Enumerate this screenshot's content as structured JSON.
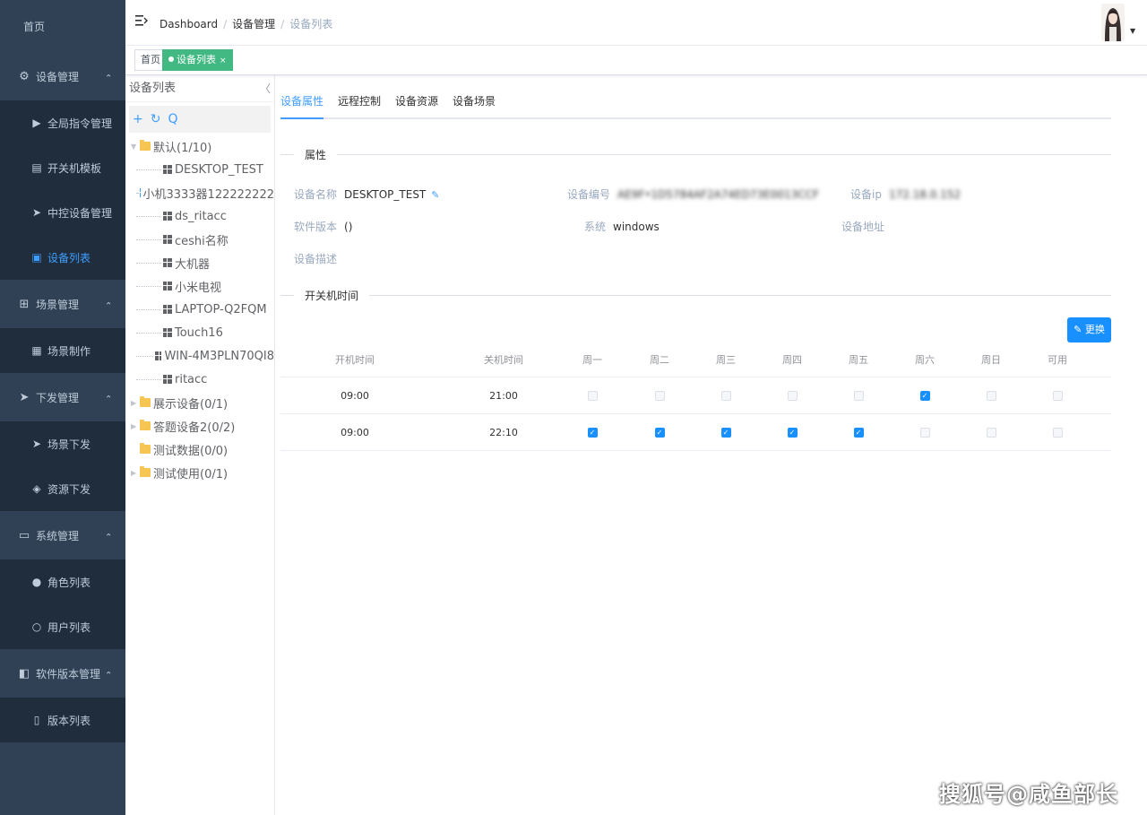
{
  "sidebar": {
    "home": "首页",
    "groups": [
      {
        "label": "设备管理",
        "icon": "gear-icon",
        "items": [
          {
            "label": "全局指令管理",
            "icon": "play-icon"
          },
          {
            "label": "开关机模板",
            "icon": "template-icon"
          },
          {
            "label": "中控设备管理",
            "icon": "send-icon"
          },
          {
            "label": "设备列表",
            "icon": "device-list-icon",
            "active": true
          }
        ]
      },
      {
        "label": "场景管理",
        "icon": "scene-icon",
        "items": [
          {
            "label": "场景制作",
            "icon": "clapper-icon"
          }
        ]
      },
      {
        "label": "下发管理",
        "icon": "send-icon",
        "items": [
          {
            "label": "场景下发",
            "icon": "send-icon"
          },
          {
            "label": "资源下发",
            "icon": "layers-icon"
          }
        ]
      },
      {
        "label": "系统管理",
        "icon": "monitor-icon",
        "items": [
          {
            "label": "角色列表",
            "icon": "users-icon"
          },
          {
            "label": "用户列表",
            "icon": "user-icon"
          }
        ]
      },
      {
        "label": "软件版本管理",
        "icon": "version-icon",
        "items": [
          {
            "label": "版本列表",
            "icon": "document-icon"
          }
        ]
      }
    ]
  },
  "header": {
    "breadcrumb": [
      "Dashboard",
      "设备管理",
      "设备列表"
    ]
  },
  "tags": {
    "home": "首页",
    "active": "设备列表",
    "close": "×"
  },
  "tree": {
    "title": "设备列表",
    "collapse": "〈",
    "tools": {
      "add": "+",
      "refresh": "↻",
      "search": "Q"
    },
    "groups": [
      {
        "label": "默认(1/10)",
        "expanded": true,
        "children": [
          {
            "label": "DESKTOP_TEST",
            "online": false
          },
          {
            "label": "小机3333器122222222",
            "online": true
          },
          {
            "label": "ds_ritacc",
            "online": false
          },
          {
            "label": "ceshi名称",
            "online": false
          },
          {
            "label": "大机器",
            "online": false
          },
          {
            "label": "小米电视",
            "online": false
          },
          {
            "label": "LAPTOP-Q2FQM",
            "online": false
          },
          {
            "label": "Touch16",
            "online": false
          },
          {
            "label": "WIN-4M3PLN70QI8",
            "online": false
          },
          {
            "label": "ritacc",
            "online": false
          }
        ]
      },
      {
        "label": "展示设备(0/1)",
        "expanded": false,
        "has_arrow": true
      },
      {
        "label": "答题设备2(0/2)",
        "expanded": false,
        "has_arrow": true
      },
      {
        "label": "测试数据(0/0)",
        "expanded": false,
        "has_arrow": false
      },
      {
        "label": "测试使用(0/1)",
        "expanded": false,
        "has_arrow": true
      }
    ]
  },
  "tabs": [
    "设备属性",
    "远程控制",
    "设备资源",
    "设备场景"
  ],
  "properties": {
    "section_title": "属性",
    "name_label": "设备名称",
    "name_value": "DESKTOP_TEST",
    "id_label": "设备编号",
    "id_value": "AE9F•1D5784AF2A74ED73E0013CCF",
    "ip_label": "设备ip",
    "ip_value": "172.18.0.152",
    "version_label": "软件版本",
    "version_value": "()",
    "system_label": "系统",
    "system_value": "windows",
    "address_label": "设备地址",
    "address_value": "",
    "desc_label": "设备描述",
    "desc_value": ""
  },
  "schedule": {
    "section_title": "开关机时间",
    "change_button": "更换",
    "headers": [
      "开机时间",
      "关机时间",
      "周一",
      "周二",
      "周三",
      "周四",
      "周五",
      "周六",
      "周日",
      "可用"
    ],
    "rows": [
      {
        "on": "09:00",
        "off": "21:00",
        "days": [
          false,
          false,
          false,
          false,
          false,
          true,
          false,
          false
        ]
      },
      {
        "on": "09:00",
        "off": "22:10",
        "days": [
          true,
          true,
          true,
          true,
          true,
          false,
          false,
          false
        ]
      }
    ]
  },
  "colors": {
    "sidebar_bg": "#304156",
    "submenu_bg": "#1f2d3d",
    "primary": "#409eff",
    "tag_active": "#42b983"
  },
  "watermark": "搜狐号@咸鱼部长"
}
